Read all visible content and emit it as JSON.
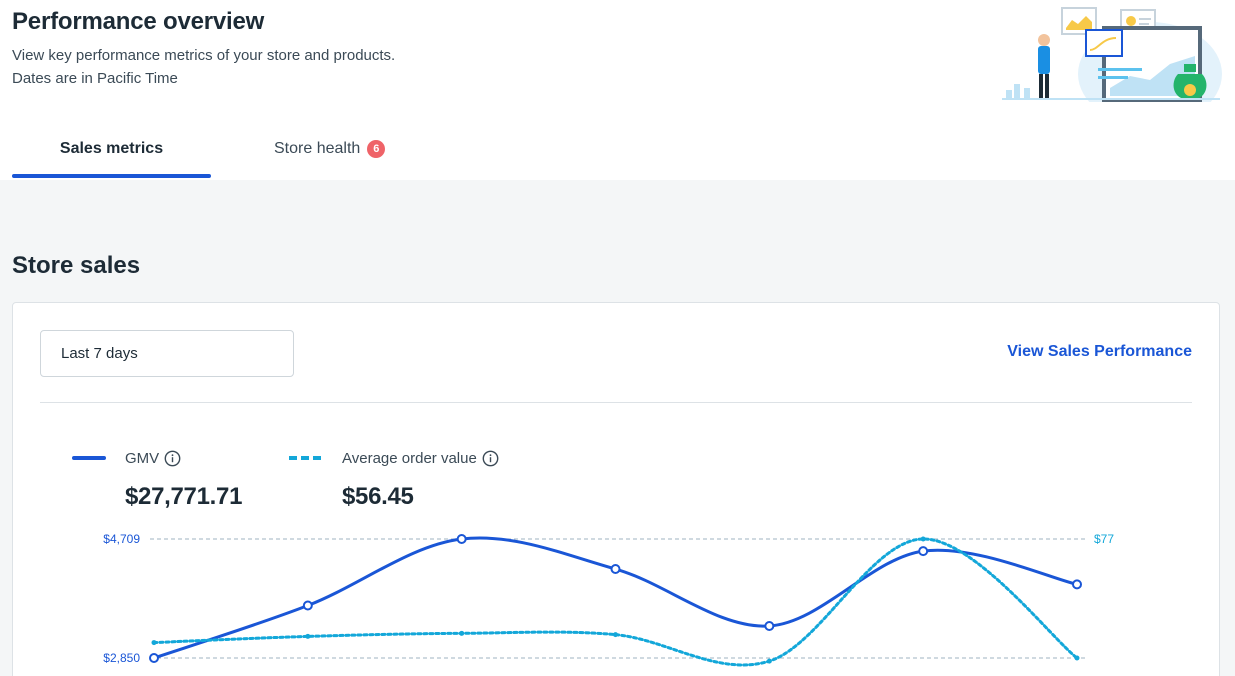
{
  "header": {
    "title": "Performance overview",
    "subtitle_line1": "View key performance metrics of your store and products.",
    "subtitle_line2": "Dates are in Pacific Time"
  },
  "tabs": [
    {
      "label": "Sales metrics",
      "active": true
    },
    {
      "label": "Store health",
      "badge": "6",
      "active": false
    }
  ],
  "section": {
    "title": "Store sales"
  },
  "card": {
    "date_range": "Last 7 days",
    "view_link": "View Sales Performance"
  },
  "metrics": {
    "gmv": {
      "label": "GMV",
      "value": "$27,771.71"
    },
    "aov": {
      "label": "Average order value",
      "value": "$56.45"
    }
  },
  "icons": {
    "info": "info-icon",
    "illustration": "analytics-illustration"
  },
  "colors": {
    "accent": "#1a56d6",
    "secondary": "#13a7d9",
    "badge": "#ef6368",
    "background": "#f4f6f7"
  },
  "chart_data": {
    "type": "line",
    "title": "",
    "x": [
      1,
      2,
      3,
      4,
      5,
      6,
      7
    ],
    "y_left_ticks": [
      "$4,709",
      "$2,850"
    ],
    "y_right_ticks": [
      "$77"
    ],
    "y_left_range": [
      2850,
      4709
    ],
    "y_right_range": [
      50,
      77
    ],
    "series": [
      {
        "name": "GMV",
        "axis": "left",
        "style": "solid",
        "values": [
          2850,
          3670,
          4709,
          4240,
          3350,
          4520,
          4000
        ]
      },
      {
        "name": "Average order value",
        "axis": "right",
        "style": "dashed",
        "values": [
          53.5,
          54.9,
          55.6,
          55.3,
          49.3,
          77,
          50
        ]
      }
    ]
  }
}
